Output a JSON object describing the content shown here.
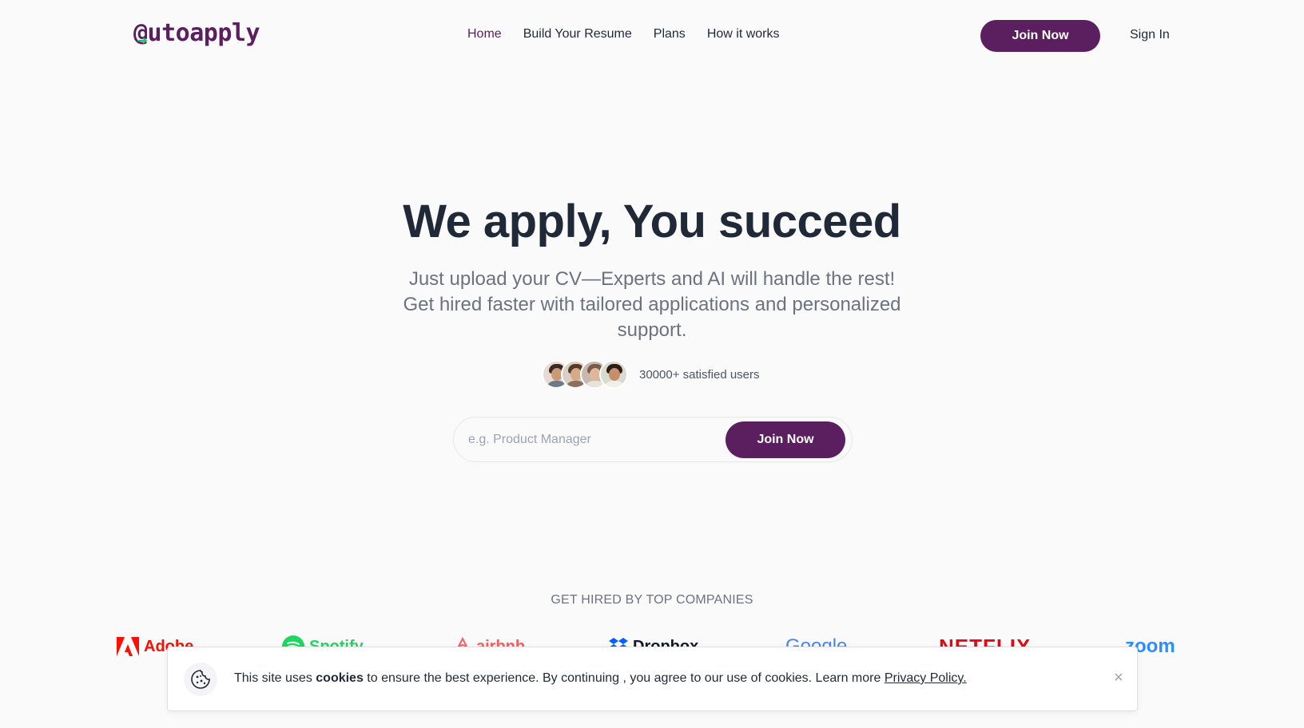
{
  "nav": {
    "logo": "@utoapply",
    "links": [
      {
        "label": "Home",
        "active": true
      },
      {
        "label": "Build Your Resume"
      },
      {
        "label": "Plans"
      },
      {
        "label": "How it works"
      }
    ],
    "join_label": "Join Now",
    "signin_label": "Sign In"
  },
  "hero": {
    "title": "We apply, You succeed",
    "subtitle": "Just upload your CV—Experts and AI will handle the rest! Get hired faster with tailored applications and personalized support.",
    "users_text": "30000+ satisfied users",
    "search_placeholder": "e.g. Product Manager",
    "search_value": "",
    "join_label": "Join Now"
  },
  "companies": {
    "title": "GET HIRED BY TOP COMPANIES",
    "logos": [
      {
        "name": "Adobe",
        "icon": "adobe-icon",
        "color": "#fa0f00"
      },
      {
        "name": "Spotify",
        "icon": "spotify-icon",
        "color": "#1ed760"
      },
      {
        "name": "airbnb",
        "icon": "airbnb-icon",
        "color": "#ff5a5f"
      },
      {
        "name": "Dropbox",
        "icon": "dropbox-icon",
        "color": "#0061ff"
      },
      {
        "name": "Google",
        "icon": "google-icon",
        "color": "#4285f4"
      },
      {
        "name": "NETFLIX",
        "icon": "netflix-logo",
        "color": "#e50914"
      },
      {
        "name": "zoom",
        "icon": "zoom-logo",
        "color": "#2d8cff"
      }
    ]
  },
  "cookie": {
    "text_before": "This site uses ",
    "text_bold": "cookies",
    "text_after": " to ensure the best experience. By continuing , you agree to our use of cookies. Learn more ",
    "link_label": "Privacy Policy.",
    "close_label": "×"
  },
  "colors": {
    "brand": "#5b1e5e",
    "accent_green": "#22c55e",
    "background": "#fafafb"
  }
}
